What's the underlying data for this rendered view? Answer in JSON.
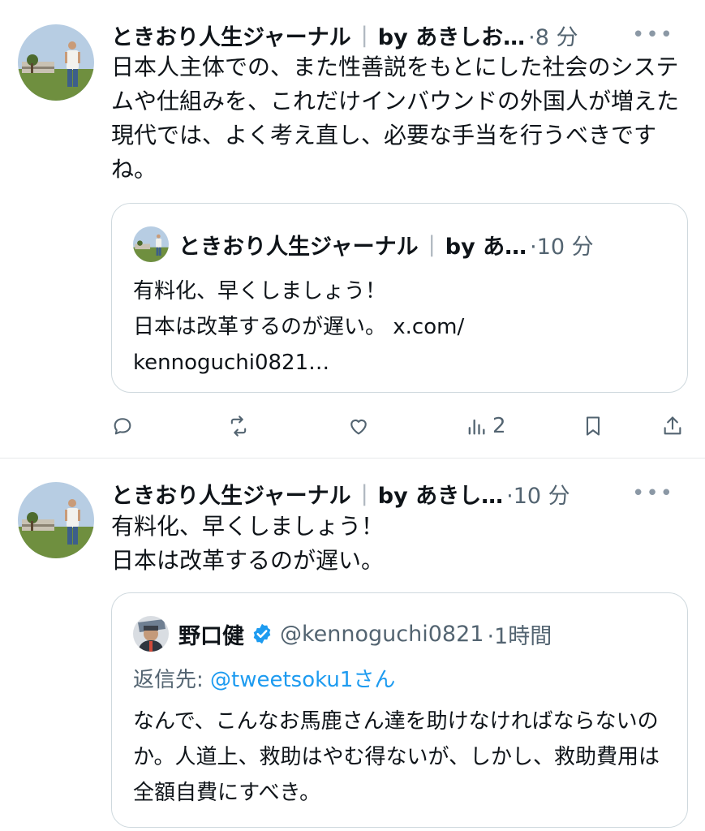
{
  "tweets": [
    {
      "author": "ときおり人生ジャーナル",
      "byline": "by あきしお…",
      "time": "8 分",
      "more": "•••",
      "text": "日本人主体での、また性善説をもとにした社会のシステムや仕組みを、これだけインバウンドの外国人が増えた現代では、よく考え直し、必要な手当を行うべきですね。",
      "quote": {
        "author": "ときおり人生ジャーナル",
        "byline": "by あ…",
        "time": "10 分",
        "text": "有料化、早くしましょう！\n日本は改革するのが遅い。 x.com/\nkennoguchi0821…"
      },
      "actions": {
        "reply_icon": "reply-icon",
        "retweet_icon": "retweet-icon",
        "like_icon": "heart-icon",
        "views_icon": "views-icon",
        "views_count": "2",
        "bookmark_icon": "bookmark-icon",
        "share_icon": "share-icon"
      }
    },
    {
      "author": "ときおり人生ジャーナル",
      "byline": "by あきし…",
      "time": "10 分",
      "more": "•••",
      "text": "有料化、早くしましょう！\n日本は改革するのが遅い。",
      "quote": {
        "author": "野口健",
        "handle": "@kennoguchi0821",
        "time": "1時間",
        "reply_label": "返信先:",
        "reply_handle": "@tweetsoku1さん",
        "text": "なんで、こんなお馬鹿さん達を助けなければならないのか。人道上、救助はやむ得ないが、しかし、救助費用は全額自費にすべき。"
      }
    }
  ],
  "colors": {
    "text": "#0f1419",
    "muted": "#536471",
    "link": "#1d9bf0",
    "border": "#cfd9de",
    "verified": "#1d9bf0"
  }
}
